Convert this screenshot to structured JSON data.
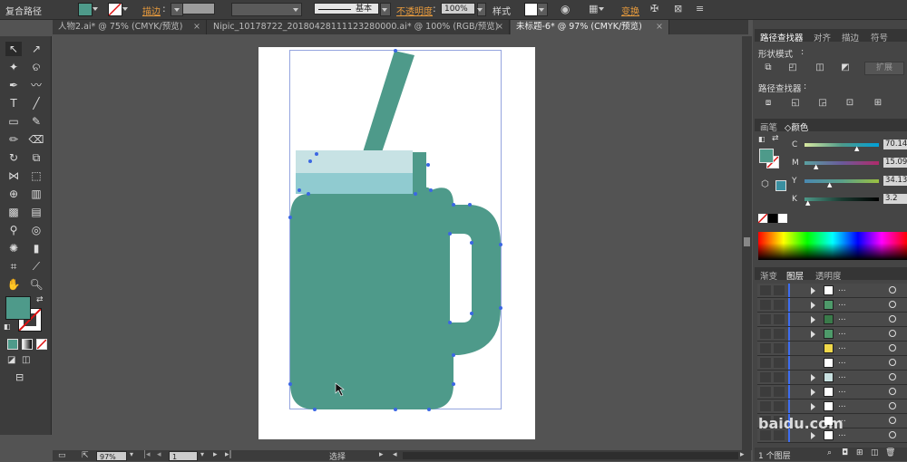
{
  "control_bar": {
    "object_type": "复合路径",
    "stroke_label": "描边",
    "stroke_style": "基本",
    "opacity_label": "不透明度",
    "opacity_value": "100%",
    "style_label": "样式",
    "transform_label": "变换",
    "fill_color": "#4e9a8a"
  },
  "tabs": [
    {
      "label": "人物2.ai* @ 75% (CMYK/预览)"
    },
    {
      "label": "Nipic_10178722_20180428111123280000.ai* @ 100% (RGB/预览)"
    },
    {
      "label": "未标题-6* @ 97% (CMYK/预览)"
    }
  ],
  "pathfinder": {
    "tabs": [
      "路径查找器",
      "对齐",
      "描边",
      "符号"
    ],
    "shape_modes_label": "形状模式",
    "pathfinders_label": "路径查找器",
    "expand_label": "扩展"
  },
  "color_panel": {
    "tabs": [
      "画笔",
      "颜色"
    ],
    "channels": [
      {
        "name": "C",
        "value": "70.14",
        "pct": 0.7
      },
      {
        "name": "M",
        "value": "15.09",
        "pct": 0.15
      },
      {
        "name": "Y",
        "value": "34.13",
        "pct": 0.34
      },
      {
        "name": "K",
        "value": "3.2",
        "pct": 0.03
      }
    ],
    "fill_color": "#4e9a8a"
  },
  "layers_panel": {
    "tabs": [
      "渐变",
      "图层",
      "透明度"
    ],
    "footer": "1 个图层",
    "row_label": "...",
    "rows": [
      {
        "thumb": "#ffffff",
        "expand": true
      },
      {
        "thumb": "#4e9a6a",
        "expand": true
      },
      {
        "thumb": "#3a7a4a",
        "expand": true
      },
      {
        "thumb": "#4e9a6a",
        "expand": true
      },
      {
        "thumb": "#f0d84a",
        "expand": false
      },
      {
        "thumb": "#ffffff",
        "expand": false
      },
      {
        "thumb": "#c8e0e0",
        "expand": true
      },
      {
        "thumb": "#ffffff",
        "expand": true
      },
      {
        "thumb": "#ffffff",
        "expand": true
      },
      {
        "thumb": "#ffffff",
        "expand": false
      },
      {
        "thumb": "#ffffff",
        "expand": true
      }
    ]
  },
  "status_bar": {
    "zoom": "97%",
    "page": "1",
    "tool": "选择"
  },
  "watermark": "baidu.com"
}
